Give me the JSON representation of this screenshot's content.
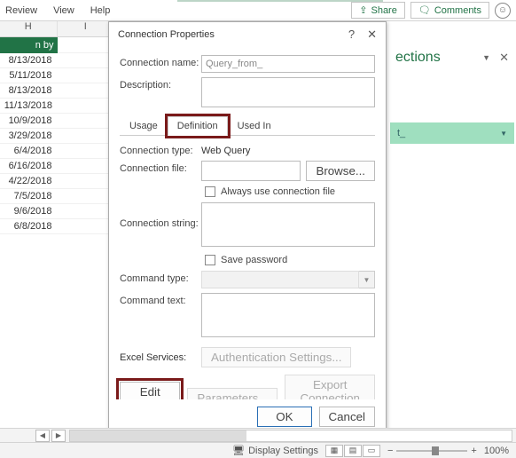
{
  "ribbon": {
    "tabs": [
      "Review",
      "View",
      "Help"
    ],
    "share": "Share",
    "comments": "Comments"
  },
  "sheet": {
    "cols": [
      "H",
      "I"
    ],
    "header_cell": "n by",
    "dates": [
      "8/13/2018",
      "5/11/2018",
      "8/13/2018",
      "11/13/2018",
      "10/9/2018",
      "3/29/2018",
      "6/4/2018",
      "6/16/2018",
      "4/22/2018",
      "7/5/2018",
      "9/6/2018",
      "6/8/2018"
    ]
  },
  "pane": {
    "title": "ections",
    "item": "t_"
  },
  "dialog": {
    "title": "Connection Properties",
    "help": "?",
    "close": "✕",
    "conn_name_label": "Connection name:",
    "conn_name_value": "Query_from_",
    "desc_label": "Description:",
    "tabs": {
      "usage": "Usage",
      "definition": "Definition",
      "usedin": "Used In"
    },
    "conn_type_label": "Connection type:",
    "conn_type_value": "Web Query",
    "conn_file_label": "Connection file:",
    "browse": "Browse...",
    "always_use": "Always use connection file",
    "conn_string_label": "Connection string:",
    "save_pw": "Save password",
    "cmd_type_label": "Command type:",
    "cmd_text_label": "Command text:",
    "excel_svc_label": "Excel Services:",
    "auth_settings": "Authentication Settings...",
    "edit_query": "Edit Query...",
    "parameters": "Parameters...",
    "export_file": "Export Connection File...",
    "ok": "OK",
    "cancel": "Cancel"
  },
  "status": {
    "display": "Display Settings",
    "zoom": "100%"
  }
}
